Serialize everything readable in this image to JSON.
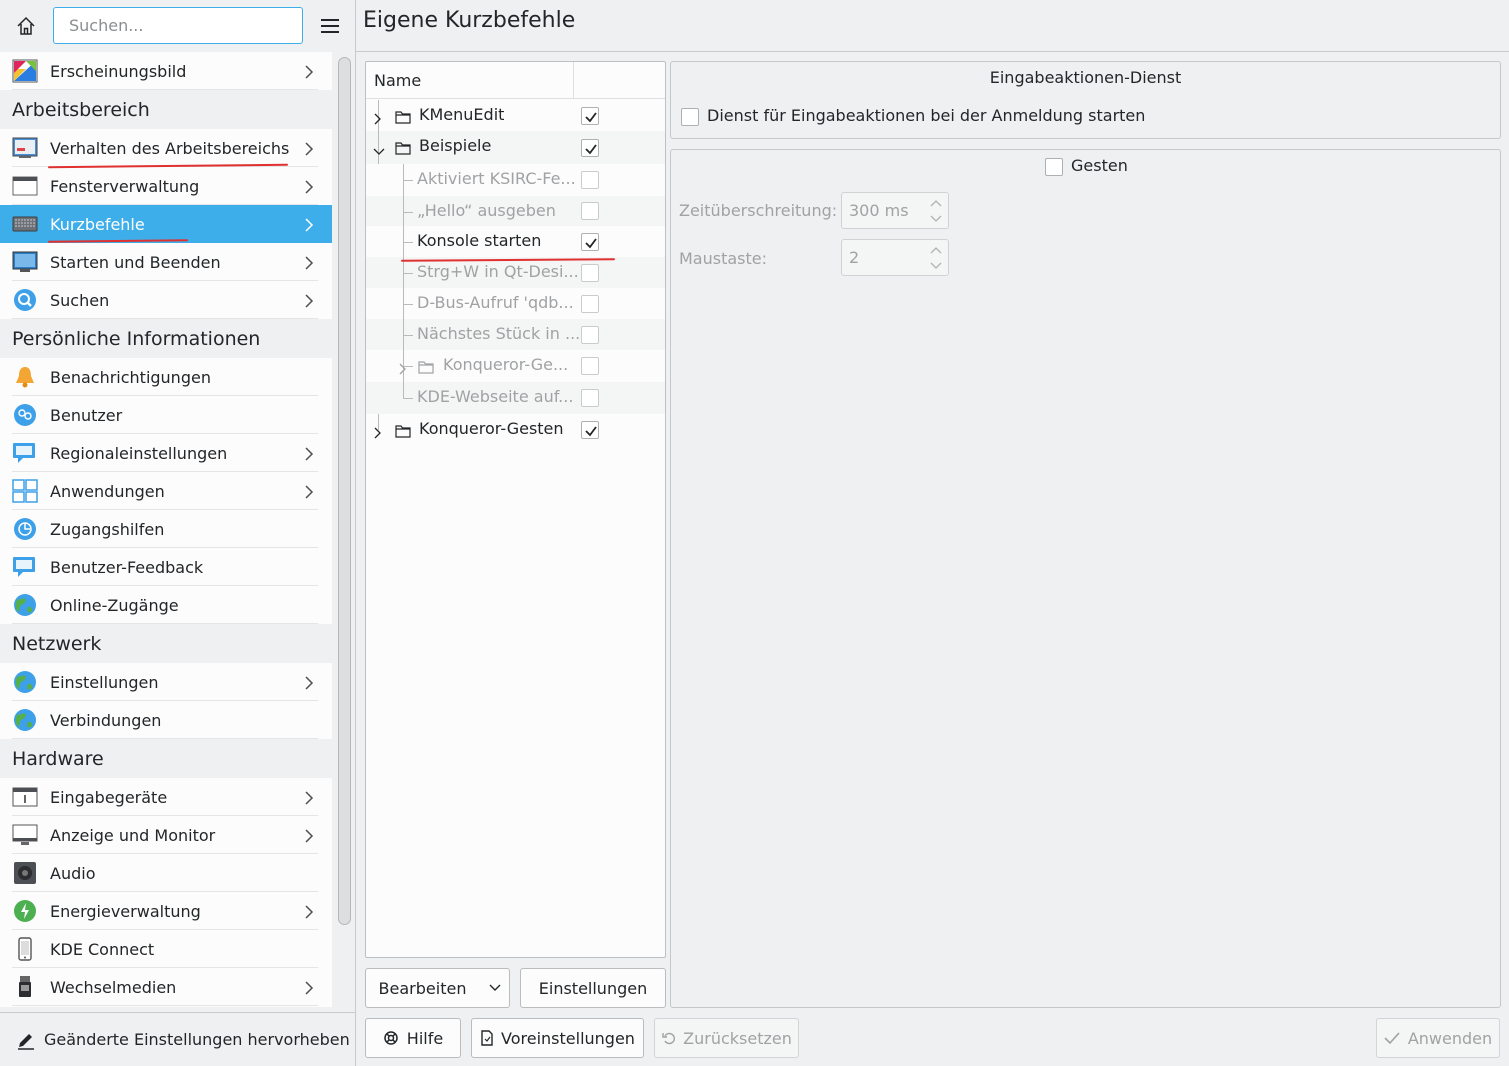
{
  "sidebar": {
    "search_placeholder": "Suchen...",
    "items": [
      {
        "type": "item",
        "label": "Erscheinungsbild",
        "icon": "appearance-icon",
        "chevron": true
      },
      {
        "type": "cat",
        "label": "Arbeitsbereich"
      },
      {
        "type": "item",
        "label": "Verhalten des Arbeitsbereichs",
        "icon": "workspace-behavior-icon",
        "chevron": true
      },
      {
        "type": "item",
        "label": "Fensterverwaltung",
        "icon": "window-management-icon",
        "chevron": true
      },
      {
        "type": "item",
        "label": "Kurzbefehle",
        "icon": "keyboard-icon",
        "chevron": true,
        "selected": true
      },
      {
        "type": "item",
        "label": "Starten und Beenden",
        "icon": "startup-shutdown-icon",
        "chevron": true
      },
      {
        "type": "item",
        "label": "Suchen",
        "icon": "search-icon",
        "chevron": true
      },
      {
        "type": "cat",
        "label": "Persönliche Informationen"
      },
      {
        "type": "item",
        "label": "Benachrichtigungen",
        "icon": "bell-icon",
        "chevron": false
      },
      {
        "type": "item",
        "label": "Benutzer",
        "icon": "users-icon",
        "chevron": false
      },
      {
        "type": "item",
        "label": "Regionaleinstellungen",
        "icon": "regional-icon",
        "chevron": true
      },
      {
        "type": "item",
        "label": "Anwendungen",
        "icon": "applications-icon",
        "chevron": true
      },
      {
        "type": "item",
        "label": "Zugangshilfen",
        "icon": "accessibility-icon",
        "chevron": false
      },
      {
        "type": "item",
        "label": "Benutzer-Feedback",
        "icon": "feedback-icon",
        "chevron": false
      },
      {
        "type": "item",
        "label": "Online-Zugänge",
        "icon": "globe-icon",
        "chevron": false
      },
      {
        "type": "cat",
        "label": "Netzwerk"
      },
      {
        "type": "item",
        "label": "Einstellungen",
        "icon": "globe-icon",
        "chevron": true
      },
      {
        "type": "item",
        "label": "Verbindungen",
        "icon": "globe-icon",
        "chevron": false
      },
      {
        "type": "cat",
        "label": "Hardware"
      },
      {
        "type": "item",
        "label": "Eingabegeräte",
        "icon": "input-devices-icon",
        "chevron": true
      },
      {
        "type": "item",
        "label": "Anzeige und Monitor",
        "icon": "monitor-icon",
        "chevron": true
      },
      {
        "type": "item",
        "label": "Audio",
        "icon": "speaker-icon",
        "chevron": false
      },
      {
        "type": "item",
        "label": "Energieverwaltung",
        "icon": "power-icon",
        "chevron": true
      },
      {
        "type": "item",
        "label": "KDE Connect",
        "icon": "phone-icon",
        "chevron": false
      },
      {
        "type": "item",
        "label": "Wechselmedien",
        "icon": "usb-icon",
        "chevron": true
      }
    ],
    "footer_label": "Geänderte Einstellungen hervorheben"
  },
  "main": {
    "title": "Eigene Kurzbefehle",
    "tree": {
      "column_name": "Name",
      "rows": [
        {
          "label": "KMenuEdit",
          "level": 0,
          "expander": "right",
          "folder": true,
          "checked": true,
          "disabled": false
        },
        {
          "label": "Beispiele",
          "level": 0,
          "expander": "down",
          "folder": true,
          "checked": true,
          "disabled": false
        },
        {
          "label": "Aktiviert KSIRC-Fe...",
          "level": 1,
          "expander": "none",
          "folder": false,
          "checked": false,
          "disabled": true
        },
        {
          "label": "„Hello“ ausgeben",
          "level": 1,
          "expander": "none",
          "folder": false,
          "checked": false,
          "disabled": true
        },
        {
          "label": "Konsole starten",
          "level": 1,
          "expander": "none",
          "folder": false,
          "checked": true,
          "disabled": false
        },
        {
          "label": "Strg+W in Qt-Desi...",
          "level": 1,
          "expander": "none",
          "folder": false,
          "checked": false,
          "disabled": true
        },
        {
          "label": "D-Bus-Aufruf 'qdb...",
          "level": 1,
          "expander": "none",
          "folder": false,
          "checked": false,
          "disabled": true
        },
        {
          "label": "Nächstes Stück in ...",
          "level": 1,
          "expander": "none",
          "folder": false,
          "checked": false,
          "disabled": true
        },
        {
          "label": "Konqueror-Ge...",
          "level": 1,
          "expander": "right",
          "folder": true,
          "checked": false,
          "disabled": true
        },
        {
          "label": "KDE-Webseite auf...",
          "level": 1,
          "expander": "none",
          "folder": false,
          "checked": false,
          "disabled": true
        },
        {
          "label": "Konqueror-Gesten",
          "level": 0,
          "expander": "right",
          "folder": true,
          "checked": true,
          "disabled": false
        }
      ]
    },
    "buttons": {
      "edit": "Bearbeiten",
      "settings": "Einstellungen"
    },
    "service_group": {
      "title": "Eingabeaktionen-Dienst",
      "start_label": "Dienst für Eingabeaktionen bei der Anmeldung starten",
      "start_checked": false
    },
    "gestures_group": {
      "title": "Gesten",
      "checked": false,
      "timeout_label": "Zeitüberschreitung:",
      "timeout_value": "300 ms",
      "mouse_label": "Maustaste:",
      "mouse_value": "2"
    }
  },
  "bottom": {
    "help": "Hilfe",
    "defaults": "Voreinstellungen",
    "reset": "Zurücksetzen",
    "apply": "Anwenden"
  },
  "colors": {
    "accent": "#3daee9",
    "annotation": "#e03030"
  }
}
